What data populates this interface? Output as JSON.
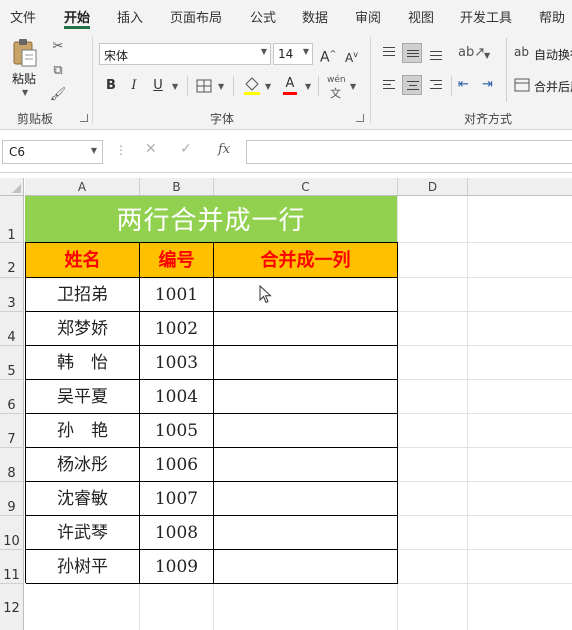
{
  "tabs": [
    {
      "label": "文件"
    },
    {
      "label": "开始",
      "active": true
    },
    {
      "label": "插入"
    },
    {
      "label": "页面布局"
    },
    {
      "label": "公式"
    },
    {
      "label": "数据"
    },
    {
      "label": "审阅"
    },
    {
      "label": "视图"
    },
    {
      "label": "开发工具"
    },
    {
      "label": "帮助"
    }
  ],
  "ribbon": {
    "clipboard": {
      "paste_label": "粘贴",
      "group_label": "剪贴板"
    },
    "font": {
      "font_name": "宋体",
      "font_size": "14",
      "grow_label": "A",
      "shrink_label": "A",
      "bold_label": "B",
      "italic_label": "I",
      "underline_label": "U",
      "font_color_label": "A",
      "phonetic_label": "wén",
      "group_label": "字体"
    },
    "alignment": {
      "wrap_text_label": "自动换行",
      "merge_center_label": "合并后居中",
      "group_label": "对齐方式"
    }
  },
  "formula_bar": {
    "name_box": "C6",
    "fx_label": "fx",
    "formula": ""
  },
  "grid": {
    "columns": [
      "A",
      "B",
      "C",
      "D"
    ],
    "rows": [
      "1",
      "2",
      "3",
      "4",
      "5",
      "6",
      "7",
      "8",
      "9",
      "10",
      "11",
      "12"
    ],
    "title": "两行合并成一行",
    "headers": [
      "姓名",
      "编号",
      "合并成一列"
    ],
    "records": [
      {
        "name": "卫招弟",
        "id": "1001",
        "merged": ""
      },
      {
        "name": "郑梦娇",
        "id": "1002",
        "merged": ""
      },
      {
        "name": "韩　怡",
        "id": "1003",
        "merged": ""
      },
      {
        "name": "吴平夏",
        "id": "1004",
        "merged": ""
      },
      {
        "name": "孙　艳",
        "id": "1005",
        "merged": ""
      },
      {
        "name": "杨冰彤",
        "id": "1006",
        "merged": ""
      },
      {
        "name": "沈睿敏",
        "id": "1007",
        "merged": ""
      },
      {
        "name": "许武琴",
        "id": "1008",
        "merged": ""
      },
      {
        "name": "孙树平",
        "id": "1009",
        "merged": ""
      }
    ]
  },
  "colors": {
    "title_fill": "#92d050",
    "header_fill": "#ffc000",
    "header_text": "#ff0000",
    "accent": "#217346"
  }
}
